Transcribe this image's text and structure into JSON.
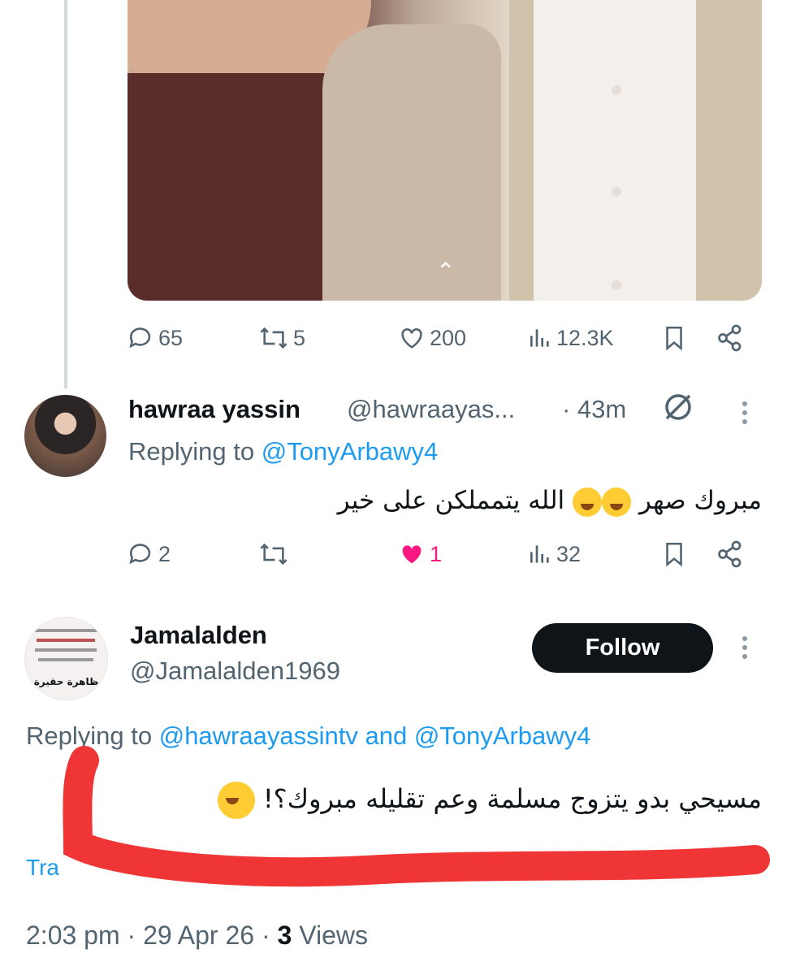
{
  "tweet1_actions": {
    "replies": "65",
    "retweets": "5",
    "likes": "200",
    "views": "12.3K"
  },
  "reply1": {
    "display_name": "hawraa yassin",
    "handle": "@hawraayas...",
    "time": "· 43m",
    "replying_prefix": "Replying to",
    "replying_to": "@TonyArbawy4",
    "text_before_emoji": "مبروك صهر",
    "text_after_emoji": "الله يتمملكن على خير",
    "actions": {
      "replies": "2",
      "likes": "1",
      "views": "32"
    }
  },
  "reply2": {
    "display_name": "Jamalalden",
    "handle": "@Jamalalden1969",
    "follow_label": "Follow",
    "replying_prefix": "Replying to",
    "replying_to_1": "@hawraayassintv",
    "replying_and": "and",
    "replying_to_2": "@TonyArbawy4",
    "text": "مسيحي بدو يتزوج مسلمة وعم تقليله مبروك؟!",
    "translate": "Tra",
    "timestamp_time": "2:03 pm",
    "timestamp_date": "29 Apr 26",
    "views_count": "3",
    "views_label": "Views",
    "avatar_caption": "ظاهرة حقيرة"
  },
  "colors": {
    "accent": "#1d9bf0",
    "muted": "#536471",
    "like_active": "#f91880",
    "annotation": "#ef3535"
  }
}
